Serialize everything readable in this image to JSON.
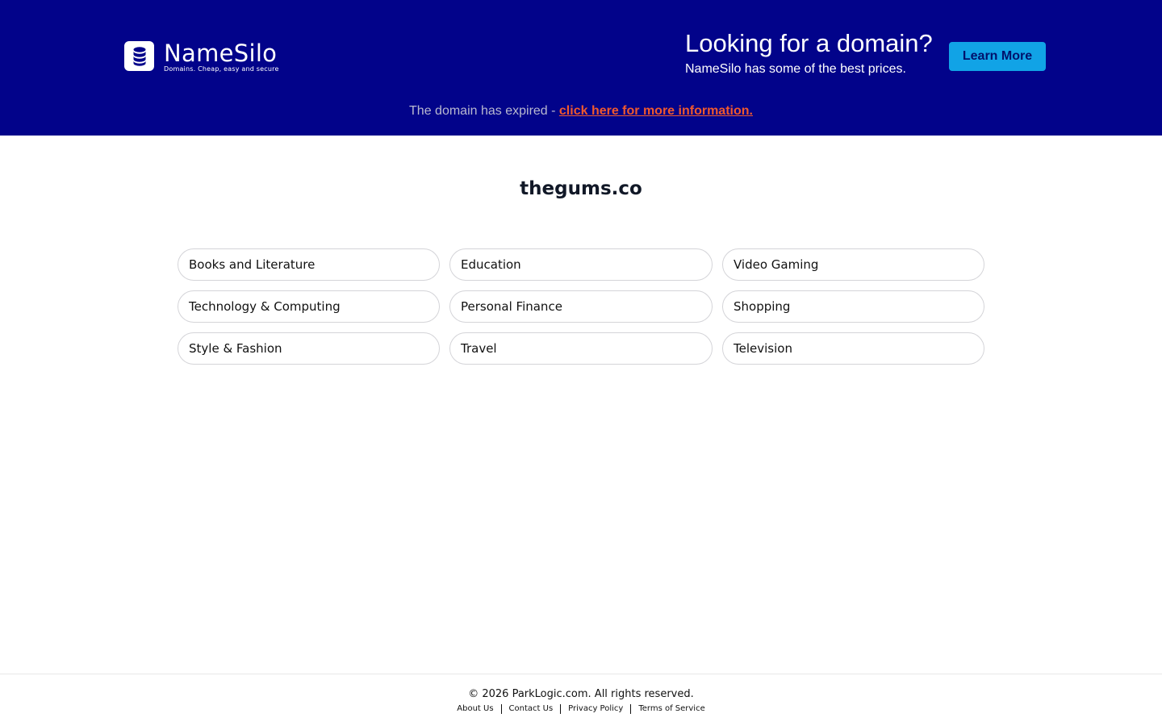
{
  "banner": {
    "logo_name": "NameSilo",
    "logo_tagline": "Domains. Cheap, easy and secure",
    "promo_title": "Looking for a domain?",
    "promo_subtitle": "NameSilo has some of the best prices.",
    "learn_more_label": "Learn More",
    "expired_text": "The domain has expired - ",
    "expired_link": "click here for more information.",
    "colors": {
      "background": "#02038a",
      "button": "#11a3e6",
      "link": "#f0592e"
    }
  },
  "main": {
    "domain": "thegums.co",
    "categories": [
      "Books and Literature",
      "Education",
      "Video Gaming",
      "Technology & Computing",
      "Personal Finance",
      "Shopping",
      "Style & Fashion",
      "Travel",
      "Television"
    ]
  },
  "footer": {
    "copyright": "© 2026 ParkLogic.com. All rights reserved.",
    "links": [
      "About Us",
      "Contact Us",
      "Privacy Policy",
      "Terms of Service"
    ]
  },
  "icons": {
    "logo": "database-icon"
  }
}
